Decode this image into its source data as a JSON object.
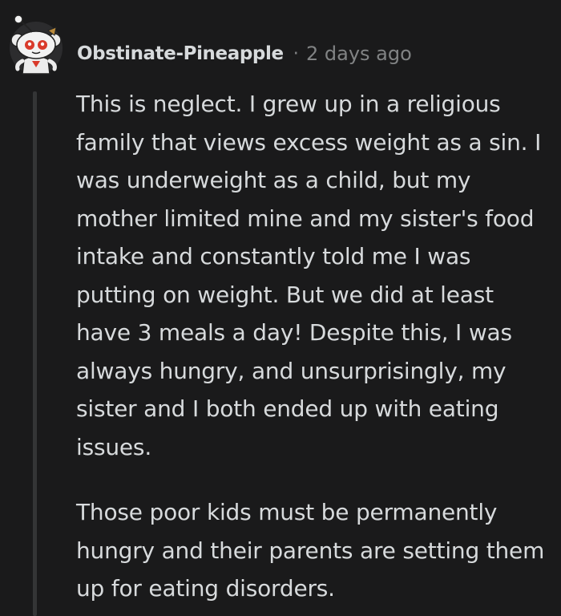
{
  "comment": {
    "author": "Obstinate-Pineapple",
    "separator": "·",
    "timestamp": "2 days ago",
    "avatar_icon": "snoo-avatar-icon",
    "paragraphs": [
      "This is neglect. I grew up in a religious family that views excess weight as a sin. I was underweight as a child, but my mother limited mine and my sister's food intake and constantly told me I was putting on weight. But we did at least have 3 meals a day! Despite this, I was always hungry, and unsurprisingly, my sister and I both ended up with eating issues.",
      "Those poor kids must be permanently hungry and their parents are setting them up for eating disorders."
    ]
  },
  "colors": {
    "background": "#1a1a1b",
    "text": "#d7dadc",
    "meta": "#818384",
    "thread_line": "#343536"
  }
}
